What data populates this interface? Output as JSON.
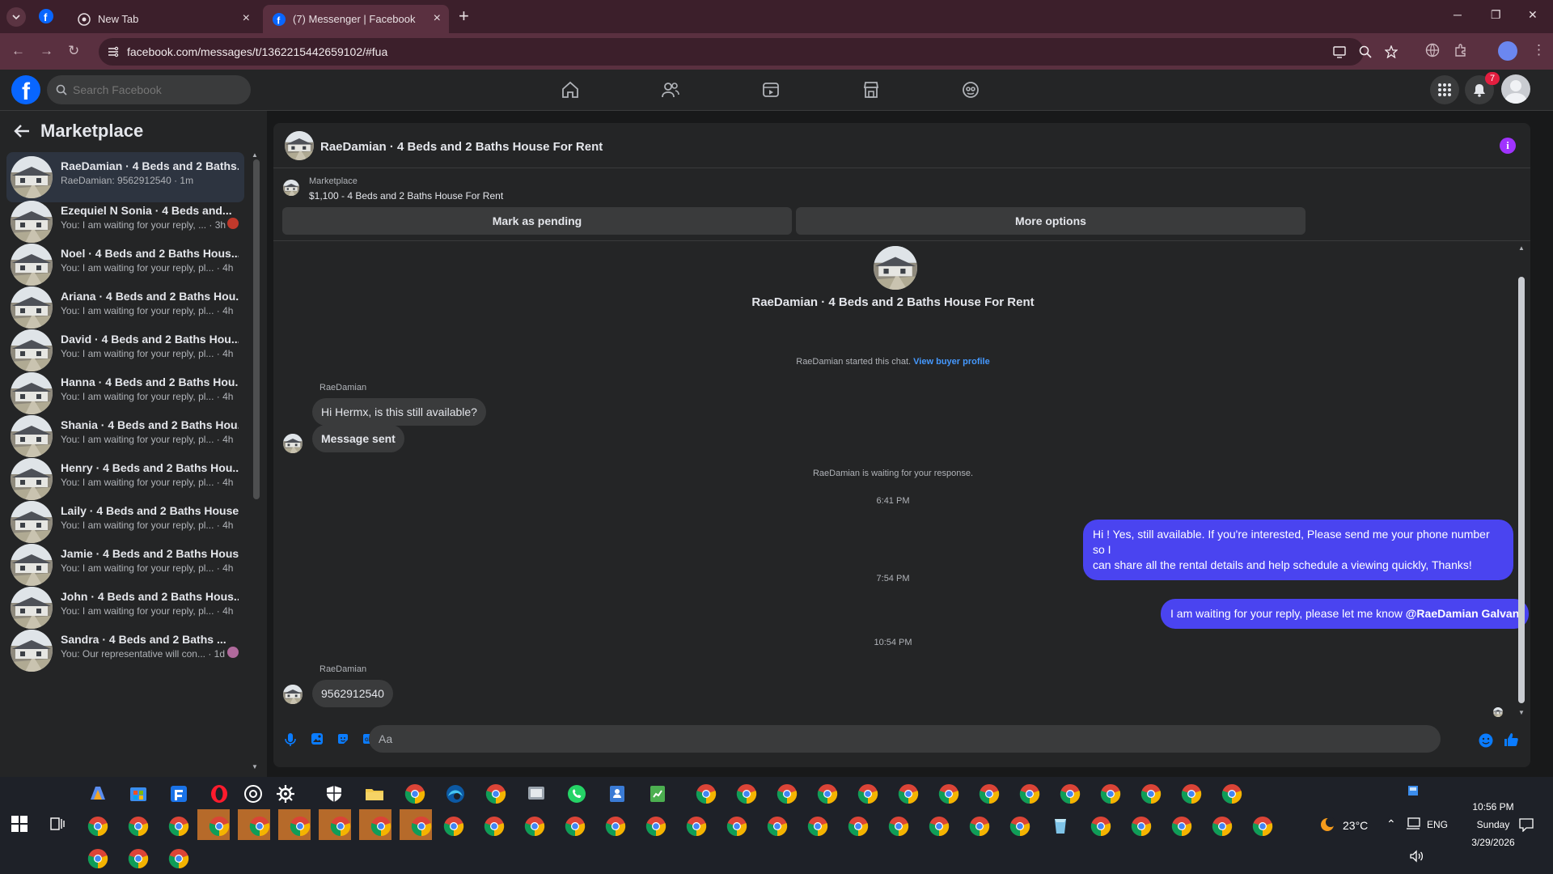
{
  "browser": {
    "tabs": [
      {
        "label": "New Tab",
        "icon": "chrome-new-tab-icon",
        "active": false
      },
      {
        "label": "(7) Messenger | Facebook",
        "icon": "facebook-icon",
        "active": true
      }
    ],
    "url": "facebook.com/messages/t/1362215442659102/#fua",
    "theme_color": "#5a3040"
  },
  "facebook": {
    "search_placeholder": "Search Facebook",
    "notification_count": "7",
    "brand_color": "#0866ff"
  },
  "sidebar": {
    "title": "Marketplace",
    "conversations": [
      {
        "name": "RaeDamian · 4 Beds and 2 Baths...",
        "preview": "RaeDamian: 9562912540 · 1m",
        "active": true
      },
      {
        "name": "Ezequiel N Sonia · 4 Beds and...",
        "preview": "You: I am waiting for your reply, ... · 3h"
      },
      {
        "name": "Noel · 4 Beds and 2 Baths Hous...",
        "preview": "You: I am waiting for your reply, pl... · 4h"
      },
      {
        "name": "Ariana · 4 Beds and 2 Baths Hou...",
        "preview": "You: I am waiting for your reply, pl... · 4h"
      },
      {
        "name": "David · 4 Beds and 2 Baths Hou...",
        "preview": "You: I am waiting for your reply, pl... · 4h"
      },
      {
        "name": "Hanna · 4 Beds and 2 Baths Hou...",
        "preview": "You: I am waiting for your reply, pl... · 4h"
      },
      {
        "name": "Shania · 4 Beds and 2 Baths Hou...",
        "preview": "You: I am waiting for your reply, pl... · 4h"
      },
      {
        "name": "Henry · 4 Beds and 2 Baths Hou...",
        "preview": "You: I am waiting for your reply, pl... · 4h"
      },
      {
        "name": "Laily · 4 Beds and 2 Baths House...",
        "preview": "You: I am waiting for your reply, pl... · 4h"
      },
      {
        "name": "Jamie · 4 Beds and 2 Baths Hous...",
        "preview": "You: I am waiting for your reply, pl... · 4h"
      },
      {
        "name": "John · 4 Beds and 2 Baths Hous...",
        "preview": "You: I am waiting for your reply, pl... · 4h"
      },
      {
        "name": "Sandra · 4 Beds and 2 Baths ...",
        "preview": "You: Our representative will con... · 1d"
      }
    ]
  },
  "chat": {
    "title": "RaeDamian · 4 Beds and 2 Baths House For Rent",
    "marketplace_label": "Marketplace",
    "listing": "$1,100 - 4 Beds and 2 Baths House For Rent",
    "mark_pending": "Mark as pending",
    "more_options": "More options",
    "hero_title": "RaeDamian · 4 Beds and 2 Baths House For Rent",
    "started_text": "RaeDamian started this chat.",
    "view_buyer": "View buyer profile",
    "sender_name": "RaeDamian",
    "msg_in_1": "Hi Hermx, is this still available?",
    "msg_in_2": "Message sent",
    "waiting_text": "RaeDamian is waiting for your response.",
    "time_1": "6:41 PM",
    "msg_out_1a": "Hi ! Yes, still available. If you're interested, Please send me your phone number so I",
    "msg_out_1b": "can share all the rental details and help schedule a viewing quickly, Thanks!",
    "time_2": "7:54 PM",
    "msg_out_2": "I am waiting for your reply, please let me know",
    "msg_out_2_mention": "@RaeDamian Galvan",
    "time_3": "10:54 PM",
    "sender_name_2": "RaeDamian",
    "msg_in_3": "9562912540",
    "composer_placeholder": "Aa",
    "outgoing_color": "#4a44f0",
    "accent_color": "#a033ff"
  },
  "taskbar": {
    "weather": "23°C",
    "language": "ENG",
    "time": "10:56 PM",
    "day": "Sunday",
    "date": "3/29/2026"
  }
}
